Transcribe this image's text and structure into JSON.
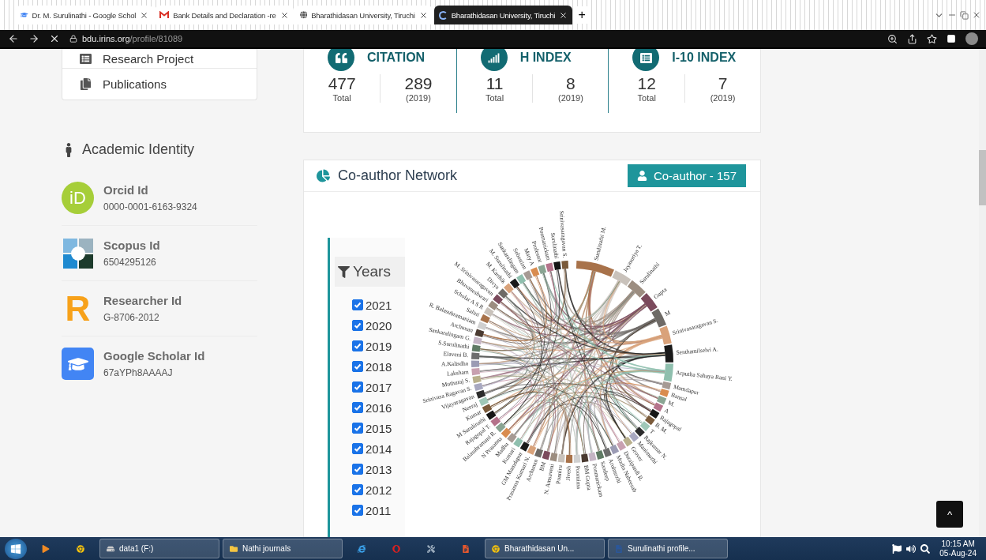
{
  "browser": {
    "tabs": [
      {
        "kind": "scholar",
        "title": "Dr. M. Surulinathi - Google Schol",
        "selected": false
      },
      {
        "kind": "mail",
        "title": "Bank Details and Declaration -re",
        "selected": false
      },
      {
        "kind": "globe",
        "title": "Bharathidasan University, Tiruchi",
        "selected": false
      },
      {
        "kind": "loading",
        "title": "Bharathidasan University, Tiruchi",
        "selected": true
      }
    ],
    "new_tab": "+",
    "url": {
      "host": "bdu.irins.org",
      "path": "/profile/81089"
    }
  },
  "sidebar": {
    "menu": [
      {
        "kind": "project",
        "label": "Research Project"
      },
      {
        "kind": "publications",
        "label": "Publications"
      }
    ],
    "identity": {
      "title": "Academic Identity",
      "items": [
        {
          "kind": "orcid",
          "logo_text": "iD",
          "label": "Orcid Id",
          "value": "0000-0001-6163-9324"
        },
        {
          "kind": "scopus",
          "label": "Scopus Id",
          "value": "6504295126"
        },
        {
          "kind": "researcher",
          "logo_text": "R",
          "label": "Researcher Id",
          "value": "G-8706-2012"
        },
        {
          "kind": "scholar",
          "label": "Google Scholar Id",
          "value": "67aYPh8AAAAJ"
        }
      ]
    }
  },
  "stats": [
    {
      "kind": "citation",
      "title": "CITATION",
      "total": "477",
      "total_label": "Total",
      "recent": "289",
      "recent_label": "(2019)"
    },
    {
      "kind": "hindex",
      "title": "H INDEX",
      "total": "11",
      "total_label": "Total",
      "recent": "8",
      "recent_label": "(2019)"
    },
    {
      "kind": "i10",
      "title": "I-10 INDEX",
      "total": "12",
      "total_label": "Total",
      "recent": "7",
      "recent_label": "(2019)"
    }
  ],
  "coauthor": {
    "title": "Co-author Network",
    "badge": "Co-author - 157",
    "filter": {
      "title": "Years",
      "years": [
        {
          "label": "2021",
          "checked": true
        },
        {
          "label": "2020",
          "checked": true
        },
        {
          "label": "2019",
          "checked": true
        },
        {
          "label": "2018",
          "checked": true
        },
        {
          "label": "2017",
          "checked": true
        },
        {
          "label": "2016",
          "checked": true
        },
        {
          "label": "2015",
          "checked": true
        },
        {
          "label": "2014",
          "checked": true
        },
        {
          "label": "2013",
          "checked": true
        },
        {
          "label": "2012",
          "checked": true
        },
        {
          "label": "2011",
          "checked": true
        }
      ]
    },
    "network_labels": [
      "Surulinathi M.",
      "Jayasuriya T.",
      "Surulinathi",
      "Gupta",
      "M",
      "Srinivasaragavan S.",
      "Senthamilselvi A.",
      "Arputha Sahaya Rani Y.",
      "Mamdapur",
      "Bansal",
      "M.",
      "A",
      "Rajagopal",
      "B. M.",
      "T",
      "Rajkumar N.",
      "Manimozhi",
      "Grover",
      "Duraipandi R.",
      "Modin Nabeesab",
      "Arulmozhi",
      "Sandeep",
      "Ponmanickam",
      "BM Gupta",
      "Poornima",
      "Jivesh",
      "Ponniru",
      "N. Amsaveni",
      "BM",
      "Archunan",
      "Prasanna Kumari N.",
      "GM Mamdapur",
      "Kumari",
      "Madhu",
      "N Prasanna",
      "Balasubramani R.",
      "Rajagopal T.",
      "M Surulinathi",
      "Kumar",
      "Neeraj",
      "Vijayaragavan",
      "Srinivasa Ragavan S.",
      "Muthuraj S.",
      "Laksham",
      "A.Kalisdha",
      "Elaveni B.",
      "S.Surulinathi",
      "Sankaralingam G.",
      "Archunan",
      "R. Balasubramaniam",
      "Salini",
      "Scholar A S R",
      "Bhuvaneshwari",
      "M. Srinivasaragavan",
      "Divya",
      "M. Karthik",
      "M. Surulinathi",
      "Sankaralingam",
      "Sebastian",
      "Mary A",
      "Professor",
      "Ponmanickam",
      "Surulinathi",
      "Srinivasaragavan S."
    ]
  },
  "scroll_top": "^",
  "taskbar": {
    "items": [
      {
        "kind": "media"
      },
      {
        "kind": "chrome"
      },
      {
        "kind": "drive",
        "label": "data1 (F:)"
      },
      {
        "kind": "folder",
        "label": "Nathi journals"
      },
      {
        "kind": "ie"
      },
      {
        "kind": "opera"
      },
      {
        "kind": "tool"
      },
      {
        "kind": "office"
      },
      {
        "kind": "chrome",
        "label": "Bharathidasan Un..."
      },
      {
        "kind": "word",
        "label": "Surulinathi profile..."
      }
    ],
    "time": "10:15 AM",
    "date": "05-Aug-24"
  }
}
